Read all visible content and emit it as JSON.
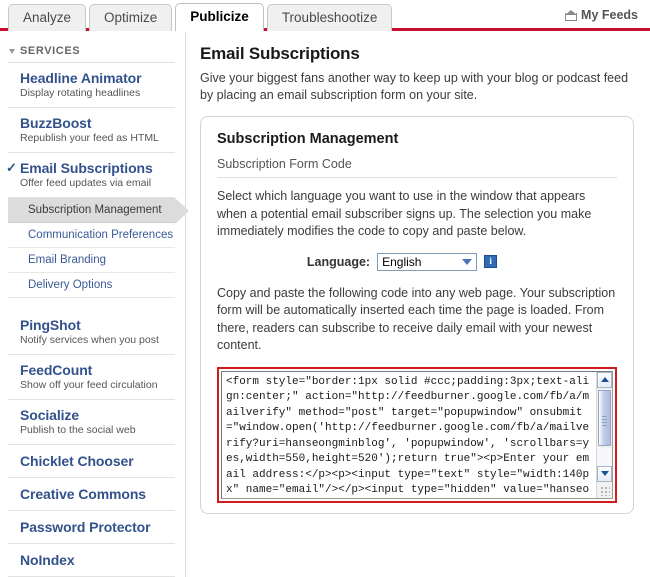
{
  "tabs": [
    {
      "label": "Analyze",
      "active": false
    },
    {
      "label": "Optimize",
      "active": false
    },
    {
      "label": "Publicize",
      "active": true
    },
    {
      "label": "Troubleshootize",
      "active": false
    }
  ],
  "header": {
    "my_feeds": "My Feeds",
    "home_icon": "home-icon"
  },
  "sidebar": {
    "section_label": "SERVICES",
    "services": [
      {
        "title": "Headline Animator",
        "sub": "Display rotating headlines",
        "checked": false
      },
      {
        "title": "BuzzBoost",
        "sub": "Republish your feed as HTML",
        "checked": false
      },
      {
        "title": "Email Subscriptions",
        "sub": "Offer feed updates via email",
        "checked": true,
        "check_mark": "✓"
      }
    ],
    "sub_items": [
      {
        "label": "Subscription Management",
        "selected": true
      },
      {
        "label": "Communication Preferences",
        "selected": false
      },
      {
        "label": "Email Branding",
        "selected": false
      },
      {
        "label": "Delivery Options",
        "selected": false
      }
    ],
    "services_2": [
      {
        "title": "PingShot",
        "sub": "Notify services when you post"
      },
      {
        "title": "FeedCount",
        "sub": "Show off your feed circulation"
      },
      {
        "title": "Socialize",
        "sub": "Publish to the social web"
      }
    ],
    "plain_items": [
      {
        "label": "Chicklet Chooser"
      },
      {
        "label": "Creative Commons"
      },
      {
        "label": "Password Protector"
      },
      {
        "label": "NoIndex"
      }
    ]
  },
  "main": {
    "page_title": "Email Subscriptions",
    "page_desc": "Give your biggest fans another way to keep up with your blog or podcast feed by placing an email subscription form on your site.",
    "card": {
      "title": "Subscription Management",
      "subtitle": "Subscription Form Code",
      "para1": "Select which language you want to use in the window that appears when a potential email subscriber signs up. The selection you make immediately modifies the code to copy and paste below.",
      "language_label": "Language:",
      "language_value": "English",
      "language_options": [
        "English"
      ],
      "info_icon_glyph": "i",
      "para2": "Copy and paste the following code into any web page. Your subscription form will be automatically inserted each time the page is loaded. From there, readers can subscribe to receive daily email with your newest content.",
      "code": "<form style=\"border:1px solid #ccc;padding:3px;text-align:center;\" action=\"http://feedburner.google.com/fb/a/mailverify\" method=\"post\" target=\"popupwindow\" onsubmit=\"window.open('http://feedburner.google.com/fb/a/mailverify?uri=hanseongminblog', 'popupwindow', 'scrollbars=yes,width=550,height=520');return true\"><p>Enter your email address:</p><p><input type=\"text\" style=\"width:140px\" name=\"email\"/></p><input type=\"hidden\" value=\"hanseongminblog\" name=\"uri\"/><input type=\"hidden\""
    }
  },
  "colors": {
    "accent_red": "#c8102e",
    "link_blue": "#33528c",
    "annotation_red": "#d01c1c",
    "selected_gray": "#dcdcdc"
  }
}
